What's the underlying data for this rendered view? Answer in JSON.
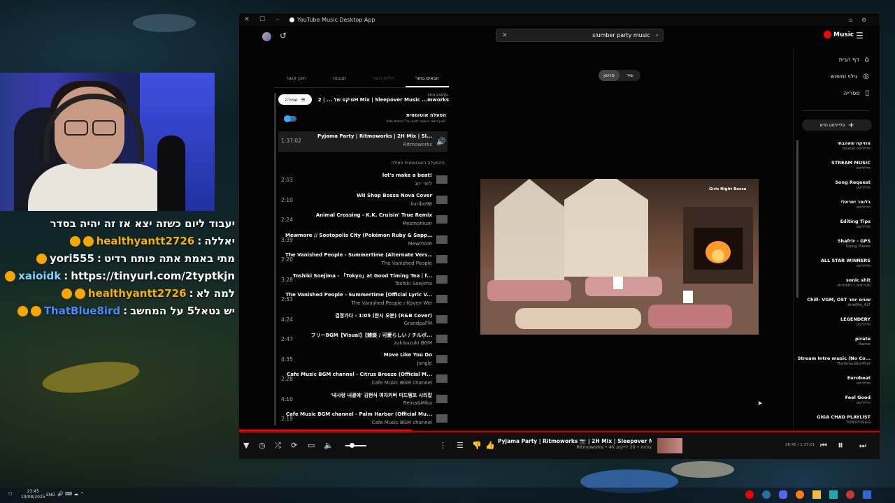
{
  "window": {
    "title": "YouTube Music Desktop App"
  },
  "search": {
    "value": "slumber party music"
  },
  "logo": {
    "text": "Music"
  },
  "sidebar": {
    "nav": [
      {
        "label": "דף הבית",
        "icon": "home-icon"
      },
      {
        "label": "גילוי ותיפוש",
        "icon": "compass-icon"
      },
      {
        "label": "ספרייה",
        "icon": "library-icon"
      }
    ],
    "new_playlist": "פלייליסט חדש",
    "playlists": [
      {
        "name": "מוזיקה שאהבתי",
        "sub": "פלייליסט אוטומטי"
      },
      {
        "name": "STREAM MUSIC",
        "sub": "פלייליסט"
      },
      {
        "name": "Song Request",
        "sub": "פלייליסט"
      },
      {
        "name": "בלומר ישראלי",
        "sub": "פלייליסט"
      },
      {
        "name": "Editing Tips",
        "sub": "פלייליסט"
      },
      {
        "name": "Shafrir - GPS",
        "sub": "Going Places"
      },
      {
        "name": "ALL STAR WINNERS",
        "sub": "פלייליסט"
      },
      {
        "name": "sonic shit",
        "sub": "strimim • סטרימים"
      },
      {
        "name": "Chill- VGM, OST שוגים יותר",
        "sub": "ArielMe_ALT"
      },
      {
        "name": "LEGENDERY",
        "sub": "פלייליסט"
      },
      {
        "name": "pirate",
        "sub": "Rance"
      },
      {
        "name": "Stream Intro music (No Co...",
        "sub": "TheSimulatorPilot"
      },
      {
        "name": "Eurobeat",
        "sub": "פלייליסט"
      },
      {
        "name": "Feel Good",
        "sub": "פלייליסט"
      },
      {
        "name": "GIGA CHAD PLAYLIST",
        "sub": "TONYPUGGG"
      }
    ]
  },
  "queue": {
    "tabs": [
      "הבאים בתור",
      "מילות השיר",
      "תגובות",
      "תוכן קשור"
    ],
    "playing_from_label": "מושמע מתוך:",
    "playing_from": "מיקס של ... | 2H Mix | Sleepover Music ...mworks",
    "save_label": "שמירה",
    "autoplay_title": "הפעלה אוטומטית",
    "autoplay_desc": "תוכן דומה יתווסף לסוף של 'הבאים בתור'",
    "autoplay_on": true,
    "current": {
      "title": "Pyjama Party | Ritmoworks | 2H Mix | Sl...",
      "artist": "Ritmoworks",
      "duration": "1:37:02"
    },
    "autoplay_section": "ההפעלה האוטומטית פעילה",
    "items": [
      {
        "title": "let's make a beat!",
        "artist": "לואי ׳זוג",
        "duration": "2:03"
      },
      {
        "title": "Wii Shop Bossa Nova Cover",
        "artist": "kuribo98",
        "duration": "2:10"
      },
      {
        "title": "Animal Crossing - K.K. Cruisin' True Remix",
        "artist": "Mesmonium",
        "duration": "2:24"
      },
      {
        "title": "Mewmore // Sootopolis City (Pokémon Ruby & Sapp...",
        "artist": "Mewmore",
        "duration": "3:39"
      },
      {
        "title": "The Vanished People - Summertime (Alternate Vers...",
        "artist": "The Vanished People",
        "duration": "2:20"
      },
      {
        "title": "Toshiki Soejima - 「Tokyo」at Good Timing Tea｜f...",
        "artist": "Toshiki Soejima",
        "duration": "3:28"
      },
      {
        "title": "The Vanished People - Summertime [Official Lyric V...",
        "artist": "The Vanished People ו-Koven Wei",
        "duration": "2:53"
      },
      {
        "title": "겁정가다 - 1:05 (한시 오분) (R&B Cover)",
        "artist": "GrandpaFM",
        "duration": "4:24"
      },
      {
        "title": "フリーBGM【Visual】【雑談 / 可愛らしい / チルボ...",
        "artist": "zukisuzuki BGM",
        "duration": "2:47"
      },
      {
        "title": "Move Like You Do",
        "artist": "Jungle",
        "duration": "4:35"
      },
      {
        "title": "Cafe Music BGM channel - Citrus Breeze (Official M...",
        "artist": "Cafe Music BGM channel",
        "duration": "2:28"
      },
      {
        "title": "'내사랑 내곁에' 김현식 여자커버 미드템포 시티팝",
        "artist": "Reina&Mika",
        "duration": "4:10"
      },
      {
        "title": "Cafe Music BGM channel - Palm Harbor (Official Mu...",
        "artist": "Cafe Music BGM channel",
        "duration": "2:19"
      }
    ]
  },
  "toggle": {
    "song": "שיר",
    "video": "סרטון"
  },
  "video": {
    "caption": "Girls Night Bossa"
  },
  "player": {
    "title": "Pyjama Party | Ritmoworks 📷 | 2H Mix | Sleepover Music",
    "meta": "Ritmoworks • 4K צפיות • 20 לייקים",
    "time": "26:40 / 1:37:01",
    "progress": 0.27
  },
  "chat": [
    {
      "user": "",
      "text": "יעבוד ליום כשזה יצא אז זה יהיה בסדר",
      "color": "#ffffff",
      "badges": 0
    },
    {
      "user": "healthyantt2726",
      "text": "יאללה",
      "color": "#f5b400",
      "badges": 2
    },
    {
      "user": "yori555",
      "text": "מתי באמת אתה פותח רדיט",
      "color": "#ffffff",
      "badges": 1
    },
    {
      "user": "xaioidk",
      "text": "https://tinyurl.com/2typtkjn",
      "color": "#7fd4ff",
      "badges": 1
    },
    {
      "user": "healthyantt2726",
      "text": "למה לא",
      "color": "#f5b400",
      "badges": 2
    },
    {
      "user": "ThatBlue8ird",
      "text": "יש גטאל5 על המחשב",
      "color": "#4a8cff",
      "badges": 2
    }
  ],
  "taskbar": {
    "time": "23:45",
    "date": "19/08/2025",
    "lang": "ENG"
  }
}
